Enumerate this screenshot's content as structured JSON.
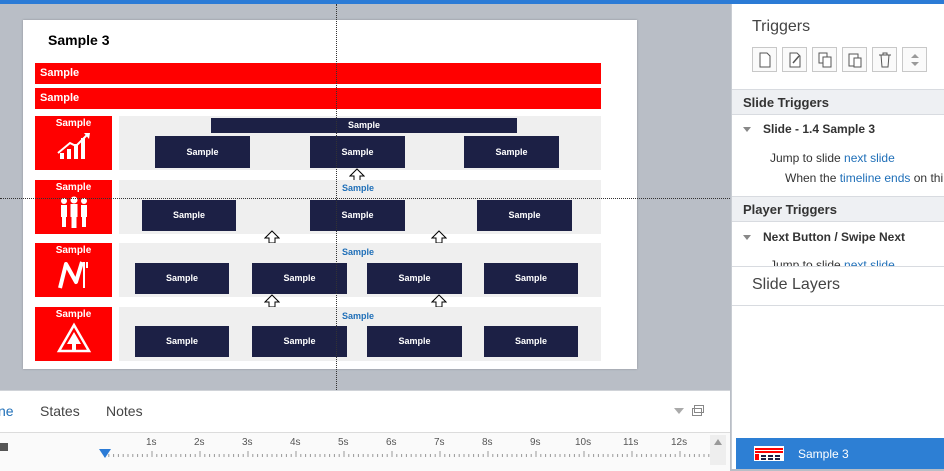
{
  "slide": {
    "title": "Sample 3",
    "bars": [
      "Sample",
      "Sample"
    ],
    "rows": [
      {
        "tile": "Sample",
        "top_bar": "Sample",
        "boxes": [
          "Sample",
          "Sample",
          "Sample"
        ]
      },
      {
        "tile": "Sample",
        "label": "Sample",
        "boxes": [
          "Sample",
          "Sample",
          "Sample"
        ]
      },
      {
        "tile": "Sample",
        "label": "Sample",
        "boxes": [
          "Sample",
          "Sample",
          "Sample",
          "Sample"
        ]
      },
      {
        "tile": "Sample",
        "label": "Sample",
        "boxes": [
          "Sample",
          "Sample",
          "Sample",
          "Sample"
        ]
      }
    ]
  },
  "right_panel": {
    "triggers_title": "Triggers",
    "toolbar_icons": [
      "new-trigger-icon",
      "edit-trigger-icon",
      "copy-icon",
      "paste-icon",
      "delete-icon",
      "move-up-down-icon"
    ],
    "slide_triggers_header": "Slide Triggers",
    "slide_trigger_group": "Slide - 1.4 Sample 3",
    "slide_trigger_action": {
      "prefix": "Jump to slide ",
      "link": "next slide"
    },
    "slide_trigger_condition": {
      "prefix": "When the ",
      "link": "timeline ends",
      "suffix": " on thi"
    },
    "player_triggers_header": "Player Triggers",
    "player_trigger_group": "Next Button / Swipe Next",
    "player_trigger_action": {
      "prefix": "Jump to slide ",
      "link": "next slide"
    },
    "layers_title": "Slide Layers",
    "layer_item": "Sample 3"
  },
  "bottom_panel": {
    "tabs": [
      "ne",
      "States",
      "Notes"
    ],
    "ruler_labels": [
      "1s",
      "2s",
      "3s",
      "4s",
      "5s",
      "6s",
      "7s",
      "8s",
      "9s",
      "10s",
      "11s",
      "12s"
    ]
  },
  "colors": {
    "accent": "#2b7bd6",
    "red": "#ff0000",
    "navy": "#1c2045",
    "link": "#1f6fb8"
  }
}
